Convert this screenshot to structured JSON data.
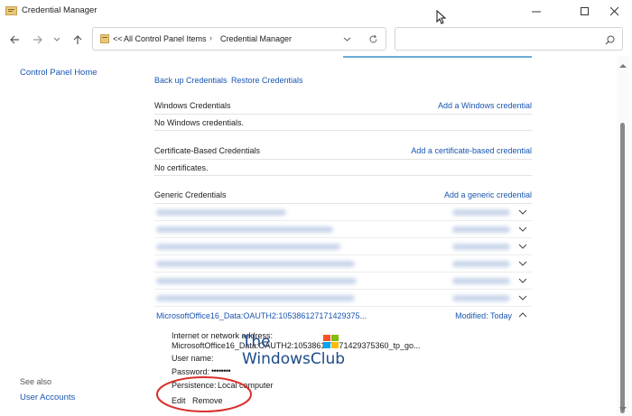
{
  "window": {
    "title": "Credential Manager"
  },
  "address": {
    "overflow": "<<",
    "crumbs": [
      "All Control Panel Items",
      "Credential Manager"
    ],
    "search_placeholder": ""
  },
  "left_pane": {
    "home": "Control Panel Home",
    "see_also": "See also",
    "user_accounts": "User Accounts"
  },
  "main": {
    "backup": "Back up Credentials",
    "restore": "Restore Credentials",
    "windows": {
      "title": "Windows Credentials",
      "add": "Add a Windows credential",
      "empty": "No Windows credentials."
    },
    "certificate": {
      "title": "Certificate-Based Credentials",
      "add": "Add a certificate-based credential",
      "empty": "No certificates."
    },
    "generic": {
      "title": "Generic Credentials",
      "add": "Add a generic credential",
      "expanded": {
        "name": "MicrosoftOffice16_Data:OAUTH2:105386127171429375...",
        "modified": "Modified:  Today",
        "address_label": "Internet or network address:",
        "address_value": "MicrosoftOffice16_Data:OAUTH2:105386127171429375360_tp_go...",
        "username_label": "User name:",
        "password_label": "Password:",
        "password_value": "••••••••",
        "persistence_label": "Persistence:",
        "persistence_value": "Local computer",
        "edit": "Edit",
        "remove": "Remove"
      }
    }
  },
  "watermark": {
    "line1": "The",
    "line2": "WindowsClub"
  },
  "colors": {
    "link": "#1a56b0",
    "annotation": "#d9302c"
  }
}
